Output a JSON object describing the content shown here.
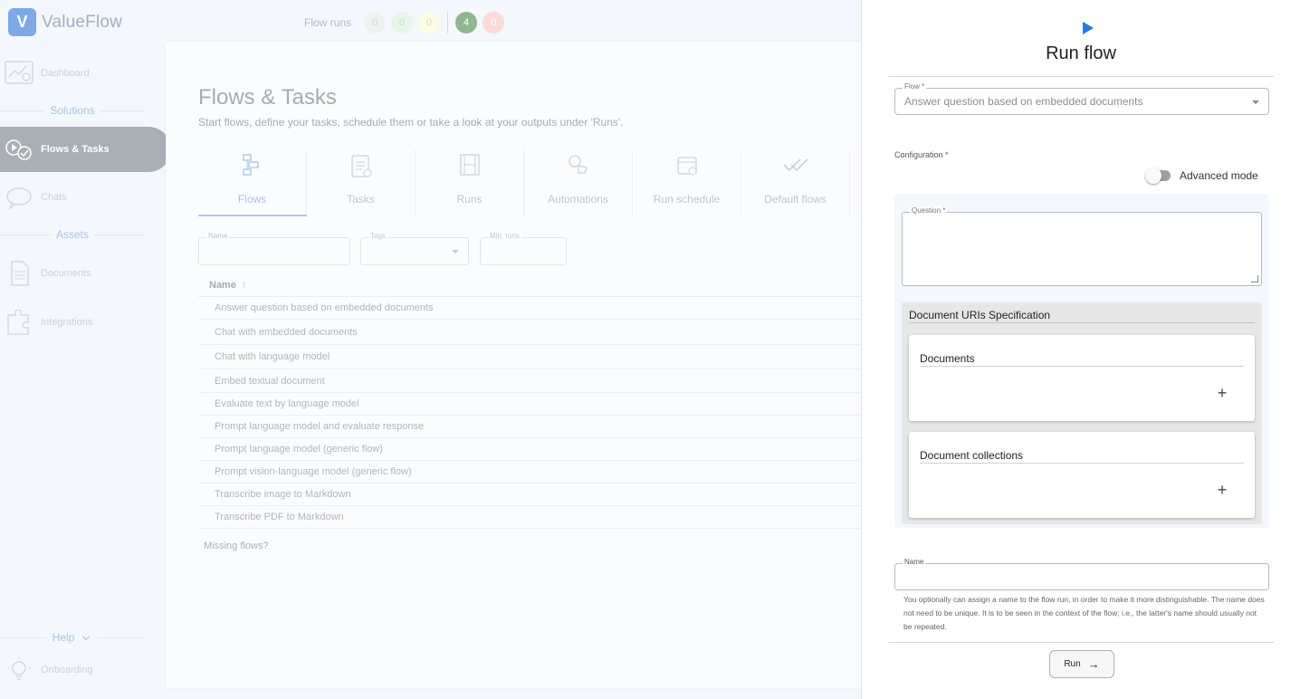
{
  "app": {
    "name": "ValueFlow",
    "logo_glyph": "V"
  },
  "topbar": {
    "label": "Flow runs",
    "badges": [
      {
        "value": "0",
        "bg": "#eef3f0",
        "fg": "#cfd8d2"
      },
      {
        "value": "0",
        "bg": "#e8f5e9",
        "fg": "#c6dcc8"
      },
      {
        "value": "0",
        "bg": "#fbfbe6",
        "fg": "#dcdcb8"
      },
      {
        "value": "4",
        "bg": "#8fb890",
        "fg": "#ffffff"
      },
      {
        "value": "0",
        "bg": "#fbdada",
        "fg": "#ffffff"
      }
    ]
  },
  "sidebar": {
    "dashboard": "Dashboard",
    "solutions": "Solutions",
    "flows_tasks": "Flows & Tasks",
    "chats": "Chats",
    "assets": "Assets",
    "documents": "Documents",
    "integrations": "Integrations",
    "help": "Help",
    "onboarding": "Onboarding"
  },
  "main": {
    "title": "Flows & Tasks",
    "subtitle": "Start flows, define your tasks, schedule them or take a look at your outputs under 'Runs'.",
    "tabs": [
      "Flows",
      "Tasks",
      "Runs",
      "Automations",
      "Run schedule",
      "Default flows"
    ],
    "filters": {
      "name": "Name",
      "tags": "Tags",
      "min_runs": "Min. runs"
    },
    "table_header": "Name",
    "rows": [
      "Answer question based on embedded documents",
      "Chat with embedded documents",
      "Chat with language model",
      "Embed textual document",
      "Evaluate text by language model",
      "Prompt language model and evaluate response",
      "Prompt language model (generic flow)",
      "Prompt vision-language model (generic flow)",
      "Transcribe image to Markdown",
      "Transcribe PDF to Markdown"
    ],
    "missing": "Missing flows?"
  },
  "drawer": {
    "title": "Run flow",
    "flow_label": "Flow *",
    "flow_value": "Answer question based on embedded documents",
    "configuration_label": "Configuration *",
    "advanced_mode": "Advanced mode",
    "question_label": "Question *",
    "spec_title": "Document URIs Specification",
    "documents_title": "Documents",
    "collections_title": "Document collections",
    "plus": "+",
    "name_label": "Name",
    "helper_text": "You optionally can assign a name to the flow run, in order to make it more distinguishable. The name does not need to be unique. It is to be seen in the context of the flow; i.e., the latter's name should usually not be repeated.",
    "run_button": "Run",
    "run_arrow": "→"
  },
  "colors": {
    "accent": "#2979e3",
    "active_nav": "#a9afb5"
  }
}
